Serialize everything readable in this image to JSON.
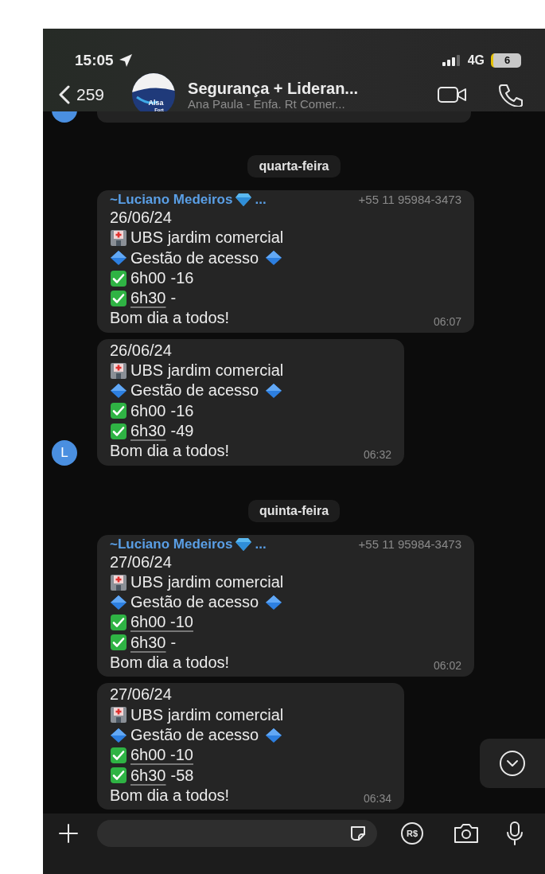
{
  "status_bar": {
    "time": "15:05",
    "network": "4G",
    "battery": "6"
  },
  "header": {
    "back_count": "259",
    "logo_lines": [
      "Alsa",
      "Fort"
    ],
    "title": "Segurança + Lideran...",
    "subtitle": "Ana  Paula - Enfa. Rt Comer..."
  },
  "chat": [
    {
      "kind": "day",
      "label": "quarta-feira"
    },
    {
      "kind": "message",
      "sender": "~Luciano Medeiros",
      "sender_more": "...",
      "phone": "+55 11 95984-3473",
      "time": "06:07",
      "lines": [
        {
          "kind": "text",
          "text": "26/06/24"
        },
        {
          "kind": "place",
          "text": "UBS jardim comercial"
        },
        {
          "kind": "title",
          "text": "Gestão de acesso"
        },
        {
          "kind": "slot",
          "main": "6h00",
          "rest": "-16",
          "underlined": false
        },
        {
          "kind": "slot",
          "main": "6h30",
          "rest": "-",
          "underlined": true
        },
        {
          "kind": "text",
          "text": "Bom dia a todos!"
        }
      ]
    },
    {
      "kind": "message",
      "avatar": "L",
      "time": "06:32",
      "lines": [
        {
          "kind": "text",
          "text": "26/06/24"
        },
        {
          "kind": "place",
          "text": "UBS jardim comercial"
        },
        {
          "kind": "title",
          "text": "Gestão de acesso"
        },
        {
          "kind": "slot",
          "main": "6h00",
          "rest": "-16",
          "underlined": false
        },
        {
          "kind": "slot",
          "main": "6h30",
          "rest": "-49",
          "underlined": true
        },
        {
          "kind": "text",
          "text": "Bom dia a todos!"
        }
      ]
    },
    {
      "kind": "day",
      "label": "quinta-feira"
    },
    {
      "kind": "message",
      "sender": "~Luciano Medeiros",
      "sender_more": "...",
      "phone": "+55 11 95984-3473",
      "time": "06:02",
      "lines": [
        {
          "kind": "text",
          "text": "27/06/24"
        },
        {
          "kind": "place",
          "text": "UBS jardim comercial"
        },
        {
          "kind": "title",
          "text": "Gestão de acesso"
        },
        {
          "kind": "slot",
          "main": "6h00 -10",
          "underlined": true
        },
        {
          "kind": "slot",
          "main": "6h30",
          "rest": "-",
          "underlined": true
        },
        {
          "kind": "text",
          "text": "Bom dia a todos!"
        }
      ]
    },
    {
      "kind": "message",
      "time": "06:34",
      "lines": [
        {
          "kind": "text",
          "text": "27/06/24"
        },
        {
          "kind": "place",
          "text": "UBS jardim comercial"
        },
        {
          "kind": "title",
          "text": "Gestão de acesso"
        },
        {
          "kind": "slot",
          "main": "6h00 -10",
          "underlined": true
        },
        {
          "kind": "slot",
          "main": "6h30",
          "rest": "-58",
          "underlined": true
        },
        {
          "kind": "text",
          "text": "Bom dia a todos!"
        }
      ]
    }
  ],
  "composer": {
    "currency_label": "R$"
  }
}
